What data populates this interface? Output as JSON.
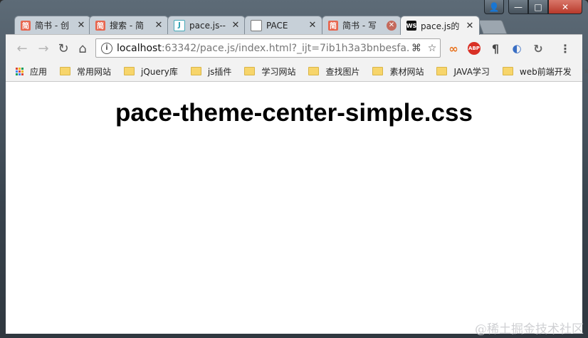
{
  "window_controls": {
    "user": "👤",
    "minimize": "—",
    "maximize": "□",
    "close": "✕"
  },
  "tabs": [
    {
      "favicon": "简",
      "title": "简书 - 创",
      "close": "✕"
    },
    {
      "favicon": "简",
      "title": "搜索 - 简",
      "close": "✕"
    },
    {
      "favicon": "J",
      "title": "pace.js--",
      "close": "✕"
    },
    {
      "favicon": "",
      "title": "PACE",
      "close": "✕"
    },
    {
      "favicon": "简",
      "title": "简书 - 写",
      "close": "✕"
    },
    {
      "favicon": "WS",
      "title": "pace.js的",
      "close": "✕"
    }
  ],
  "nav": {
    "back": "←",
    "forward": "→",
    "reload": "↻",
    "home": "⌂"
  },
  "omnibox": {
    "host": "localhost",
    "rest": ":63342/pace.js/index.html?_ijt=7ib1h3a3bnbesfa..."
  },
  "extensions": {
    "ext1": "∞",
    "abp": "ABP",
    "pilcrow": "¶",
    "ext4": "◐",
    "ext5": "↻",
    "menu": "⋮"
  },
  "bookmarks": {
    "apps": "应用",
    "items": [
      "常用网站",
      "jQuery库",
      "js插件",
      "学习网站",
      "查找图片",
      "素材网站",
      "JAVA学习",
      "web前端开发"
    ],
    "overflow": "»"
  },
  "page": {
    "heading": "pace-theme-center-simple.css"
  },
  "watermark": "@稀土掘金技术社区"
}
